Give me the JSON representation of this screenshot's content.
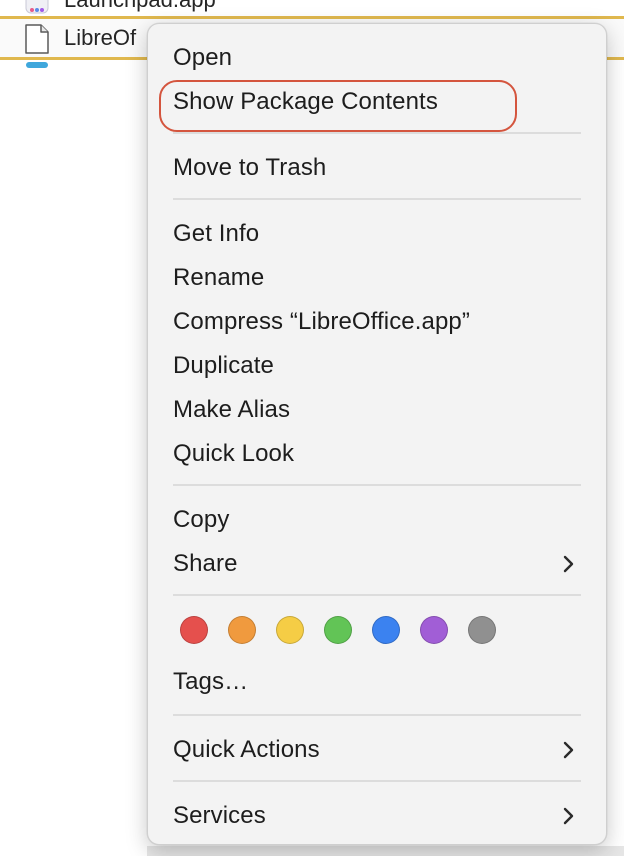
{
  "finder": {
    "row_above_name": "Launchpad.app",
    "selected_name": "LibreOffice.app",
    "selected_visible_name": "LibreOf"
  },
  "menu": {
    "open": "Open",
    "show_package_contents": "Show Package Contents",
    "move_to_trash": "Move to Trash",
    "get_info": "Get Info",
    "rename": "Rename",
    "compress": "Compress “LibreOffice.app”",
    "duplicate": "Duplicate",
    "make_alias": "Make Alias",
    "quick_look": "Quick Look",
    "copy": "Copy",
    "share": "Share",
    "tags": "Tags…",
    "quick_actions": "Quick Actions",
    "services": "Services"
  },
  "tag_colors": [
    {
      "name": "red",
      "color": "#e5504d"
    },
    {
      "name": "orange",
      "color": "#f09a3e"
    },
    {
      "name": "yellow",
      "color": "#f5cd45"
    },
    {
      "name": "green",
      "color": "#62c456"
    },
    {
      "name": "blue",
      "color": "#3b82f0"
    },
    {
      "name": "purple",
      "color": "#a15ed6"
    },
    {
      "name": "gray",
      "color": "#909090"
    }
  ],
  "colors": {
    "highlight_ring": "#d4553e",
    "selection_border": "#e0b84e"
  },
  "icons": {
    "submenu": "chevron-right-icon",
    "file": "document-icon",
    "app": "app-icon"
  }
}
